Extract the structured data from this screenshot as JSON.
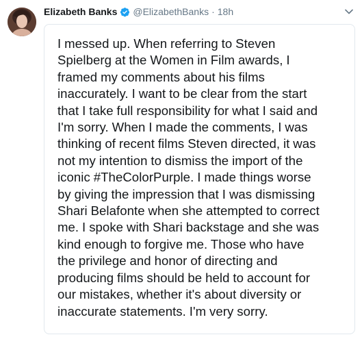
{
  "tweet": {
    "author_name": "Elizabeth Banks",
    "handle": "@ElizabethBanks",
    "separator": "·",
    "time": "18h",
    "verified_icon": "verified-badge-icon",
    "menu_icon": "chevron-down-icon",
    "image_lines": [
      "I messed up. When referring to Steven",
      "Spielberg at the Women in Film awards, I",
      "framed my comments about his films",
      "inaccurately. I want to be clear from the start",
      "that I take full responsibility for what I said and",
      "I'm sorry. When I made the comments, I was",
      "thinking of recent films Steven directed, it was",
      "not my intention to dismiss the import of the",
      "iconic #TheColorPurple. I made things worse",
      "by giving the impression that I was dismissing",
      "Shari Belafonte when she attempted to correct",
      "me. I spoke with Shari backstage and she was",
      "kind enough to forgive me. Those who have",
      "the privilege and honor of directing and",
      "producing films should be held to account for",
      "our mistakes, whether it's about diversity or",
      "inaccurate statements. I'm very sorry."
    ]
  },
  "colors": {
    "text": "#14171a",
    "secondary": "#657786",
    "verified": "#1da1f2",
    "border": "#e1e8ed"
  }
}
